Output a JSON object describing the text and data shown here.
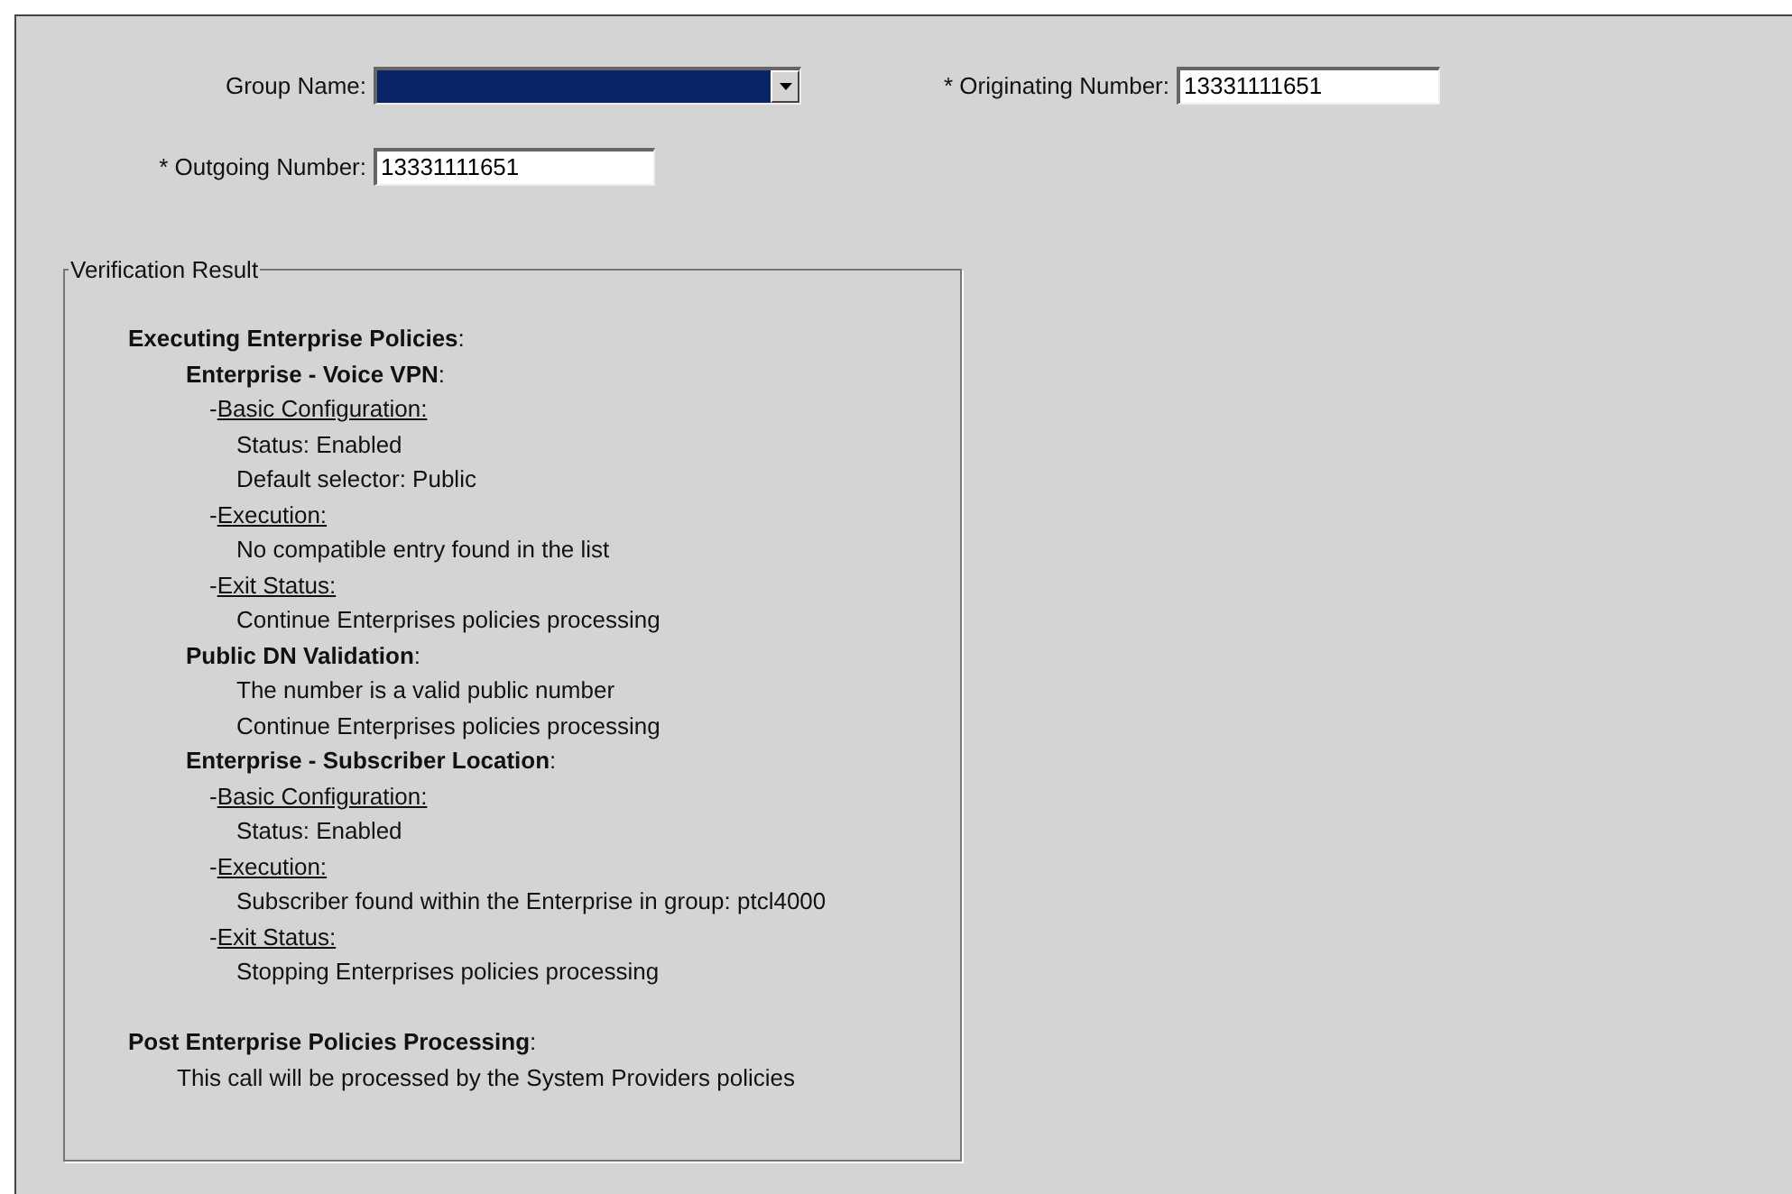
{
  "form": {
    "group_name": {
      "label": "Group Name:",
      "highlighted": true
    },
    "originating_number": {
      "label": "* Originating Number:",
      "value": "13331111651"
    },
    "outgoing_number": {
      "label": "* Outgoing Number:",
      "value": "13331111651"
    }
  },
  "verification": {
    "title": "Verification Result",
    "sections": [
      {
        "heading": "**Executing Enterprise Policies**:",
        "children": [
          {
            "heading": "**Enterprise - Voice VPN**:",
            "children": [
              {
                "marker": "-",
                "label": "Basic Configuration:",
                "lines": [
                  "Status: Enabled",
                  "Default selector: Public"
                ]
              },
              {
                "marker": "-",
                "label": "Execution:",
                "lines": [
                  "No compatible entry found in the list"
                ]
              },
              {
                "marker": "-",
                "label": "Exit Status:",
                "lines": [
                  "Continue Enterprises policies processing"
                ]
              }
            ]
          },
          {
            "heading": "**Public DN Validation**:",
            "lines": [
              "The number is a valid public number",
              "Continue Enterprises policies processing"
            ]
          },
          {
            "heading": "**Enterprise - Subscriber Location**:",
            "children": [
              {
                "marker": "-",
                "label": "Basic Configuration:",
                "lines": [
                  "Status: Enabled"
                ]
              },
              {
                "marker": "-",
                "label": "Execution:",
                "lines": [
                  "Subscriber found within the Enterprise in group: ptcl4000"
                ]
              },
              {
                "marker": "-",
                "label": "Exit Status:",
                "lines": [
                  "Stopping Enterprises policies processing"
                ]
              }
            ]
          }
        ]
      },
      {
        "heading": "**Post Enterprise Policies Processing**:",
        "lines": [
          "This call will be processed by the System Providers policies"
        ]
      }
    ]
  }
}
